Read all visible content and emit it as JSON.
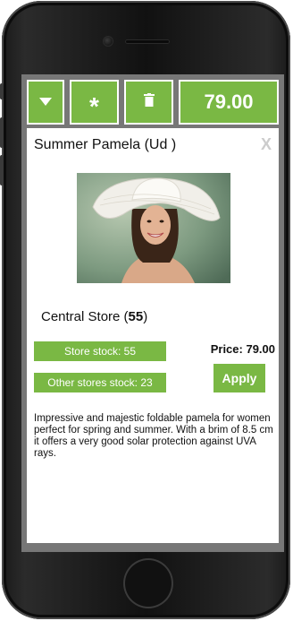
{
  "toolbar": {
    "dropdown_icon": "caret-down-icon",
    "asterisk_label": "*",
    "trash_icon": "trash-icon",
    "total": "79.00"
  },
  "product": {
    "title": "Summer Pamela (Ud )",
    "close_label": "X",
    "store_name": "Central Store (",
    "store_qty": "55",
    "store_close": ")",
    "store_stock_label": "Store stock: 55",
    "other_stock_label": "Other stores stock: 23",
    "price_label": "Price: 79.00",
    "apply_label": "Apply",
    "description": "Impressive and majestic foldable pamela for women perfect for spring and summer. With a brim of 8.5 cm it offers a very good solar protection against UVA rays."
  },
  "colors": {
    "accent": "#7ab844",
    "screen_bg": "#777777",
    "close": "#cccccc"
  }
}
